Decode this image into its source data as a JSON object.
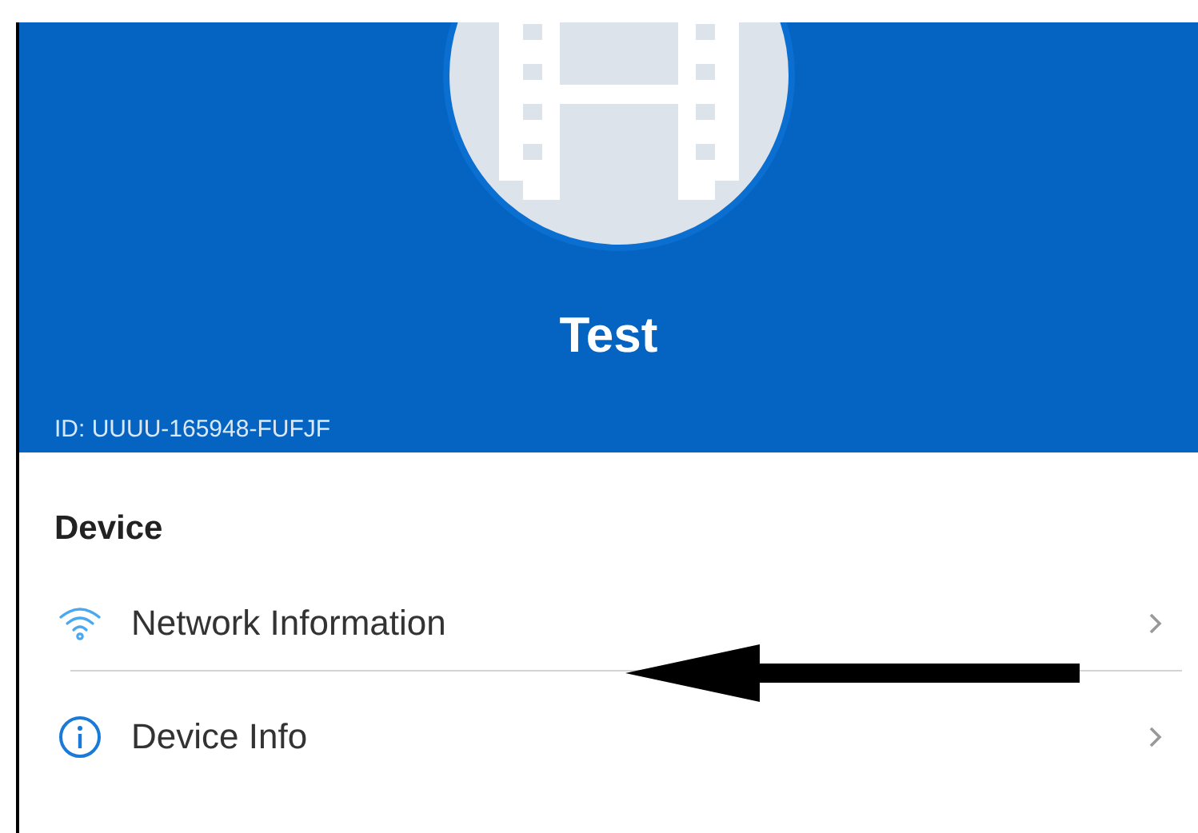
{
  "header": {
    "title": "Test",
    "id_label": "ID: UUUU-165948-FUFJF"
  },
  "section": {
    "title": "Device",
    "items": [
      {
        "kind": "wifi",
        "label": "Network Information"
      },
      {
        "kind": "info",
        "label": "Device Info"
      }
    ]
  }
}
